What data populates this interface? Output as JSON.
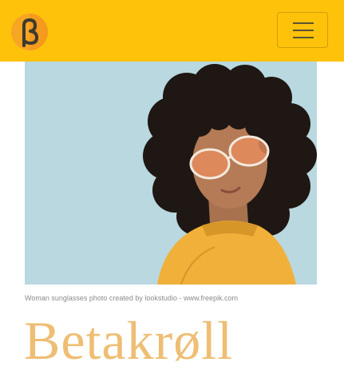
{
  "header": {
    "logo_icon": "beta-logo-icon",
    "menu_icon": "hamburger-menu-icon",
    "background_color": "#fec20a"
  },
  "hero": {
    "image": "woman-with-sunglasses-photo",
    "background_color": "#b9d8e0"
  },
  "caption": "Woman sunglasses photo created by lookstudio - www.freepik.com",
  "title": "Betakrøll",
  "colors": {
    "accent": "#eebe74",
    "caption_text": "#8b8b8b"
  }
}
